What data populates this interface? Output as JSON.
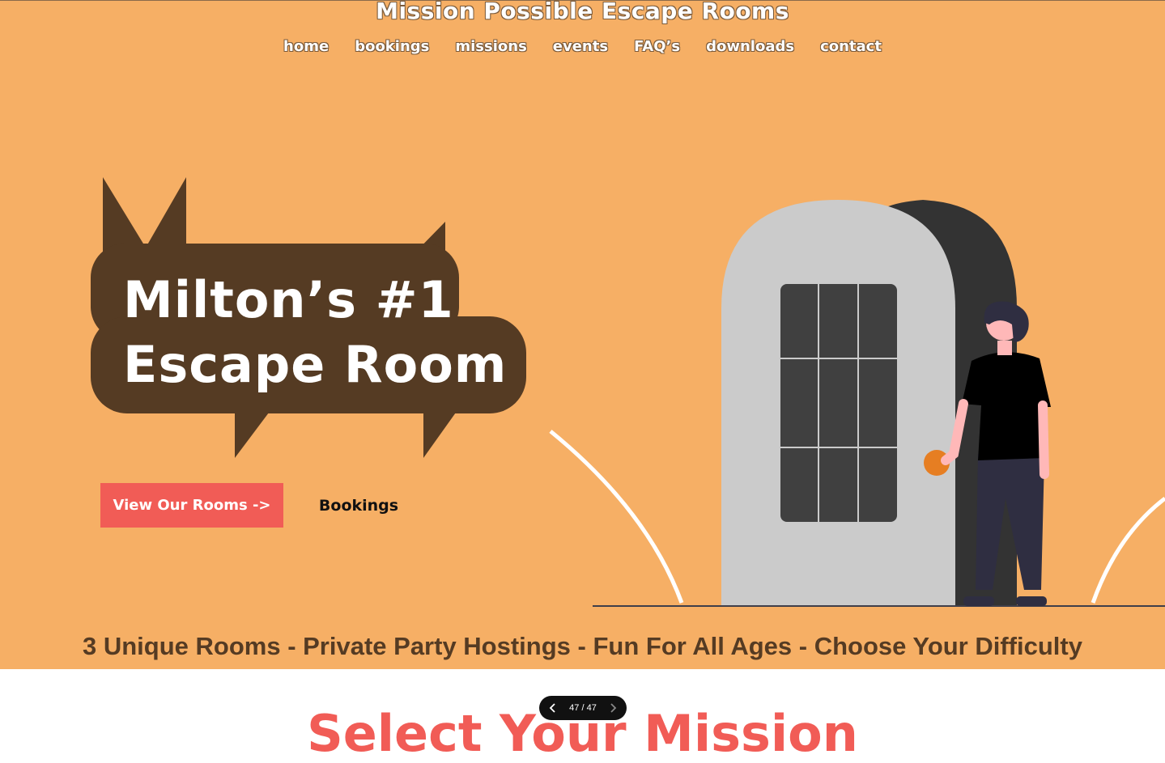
{
  "site": {
    "title": "Mission Possible Escape Rooms"
  },
  "nav": {
    "items": [
      {
        "label": "home"
      },
      {
        "label": "bookings"
      },
      {
        "label": "missions"
      },
      {
        "label": "events"
      },
      {
        "label": "FAQ’s"
      },
      {
        "label": "downloads"
      },
      {
        "label": "contact"
      }
    ]
  },
  "hero": {
    "headline_line1": "Milton’s #1",
    "headline_line2": "Escape Room",
    "primary_button": "View Our Rooms ->",
    "secondary_button": "Bookings"
  },
  "tagline": "3 Unique Rooms - Private Party Hostings - Fun For All Ages - Choose Your Difficulty",
  "next_section": {
    "title": "Select Your Mission"
  },
  "pager": {
    "text": "47 / 47"
  },
  "colors": {
    "hero_background": "#f6af65",
    "bubble": "#553b23",
    "accent_button": "#f15c56",
    "tagline": "#553b23"
  },
  "icons": {
    "pager_prev": "chevron-left-icon",
    "pager_next": "chevron-right-icon"
  }
}
